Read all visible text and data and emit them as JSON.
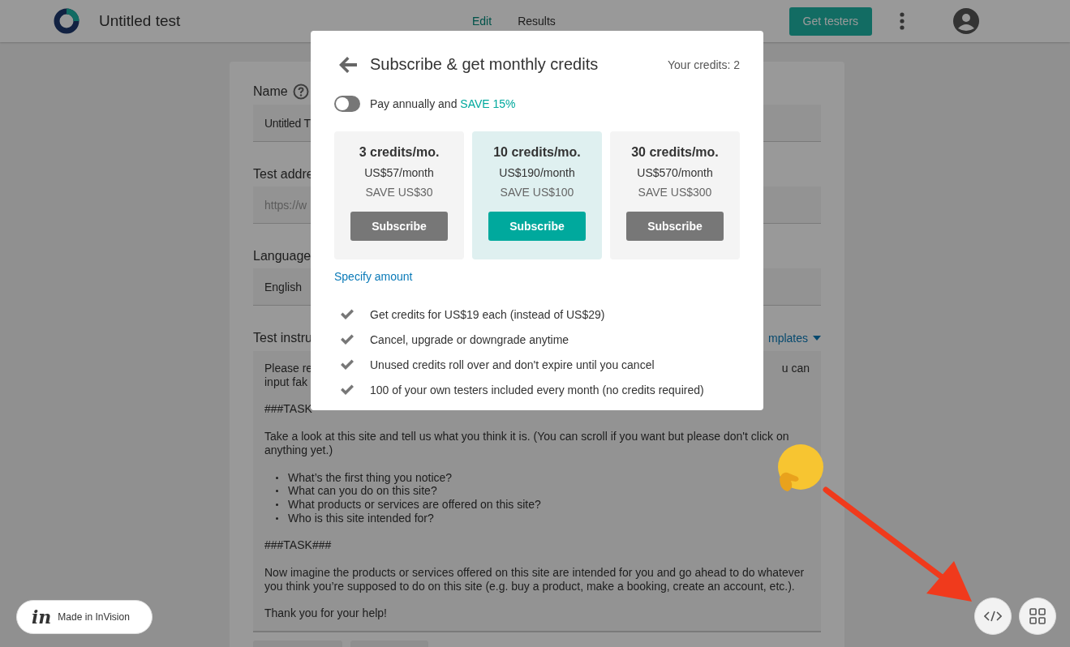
{
  "app_bar": {
    "title": "Untitled test",
    "tabs": [
      {
        "label": "Edit",
        "selected": true
      },
      {
        "label": "Results",
        "selected": false
      }
    ],
    "action": "Get testers"
  },
  "form": {
    "name_label": "Name",
    "name_value": "Untitled T",
    "address_label": "Test addre",
    "address_placeholder": "https://w",
    "language_label": "Language",
    "language_value": "English",
    "instructions_label": "Test instru",
    "templates_link": "mplates",
    "instructions": [
      {
        "kind": "paragraph",
        "lines": [
          "Please re",
          "input fak"
        ],
        "tail": "u can"
      },
      {
        "kind": "paragraph",
        "lines": [
          "###TASK"
        ]
      },
      {
        "kind": "paragraph",
        "lines": [
          "Take a look at this site and tell us what you think it is. (You can scroll if you want but please don't click on",
          "anything yet.)"
        ]
      },
      {
        "kind": "bullets",
        "lines": [
          "What’s the first thing you notice?",
          "What can you do on this site?",
          "What products or services are offered on this site?",
          "Who is this site intended for?"
        ]
      },
      {
        "kind": "paragraph",
        "lines": [
          "###TASK###"
        ]
      },
      {
        "kind": "paragraph",
        "lines": [
          "Now imagine the products or services offered on this site are intended for you and go ahead to do whatever",
          "you think you’re supposed to do on this site (e.g. buy a product, make a booking, create an account, etc.)."
        ]
      },
      {
        "kind": "paragraph",
        "lines": [
          "Thank you for your help!"
        ]
      }
    ]
  },
  "modal": {
    "title": "Subscribe & get monthly credits",
    "credits": "Your credits: 2",
    "toggle": {
      "label": "Pay annually and",
      "highlight": "SAVE 15%",
      "on": false
    },
    "plans": [
      {
        "title": "3 credits/mo.",
        "price": "US$57/month",
        "saving": "SAVE US$30",
        "button": "Subscribe",
        "selected": false
      },
      {
        "title": "10 credits/mo.",
        "price": "US$190/month",
        "saving": "SAVE US$100",
        "button": "Subscribe",
        "selected": true
      },
      {
        "title": "30 credits/mo.",
        "price": "US$570/month",
        "saving": "SAVE US$300",
        "button": "Subscribe",
        "selected": false
      }
    ],
    "link": "Specify amount",
    "features": [
      "Get credits for US$19 each (instead of US$29)",
      "Cancel, upgrade or downgrade anytime",
      "Unused credits roll over and don't expire until you cancel",
      "100 of your own testers included every month (no credits required)"
    ]
  },
  "badge": {
    "logo": "in",
    "label": "Made in InVision"
  }
}
